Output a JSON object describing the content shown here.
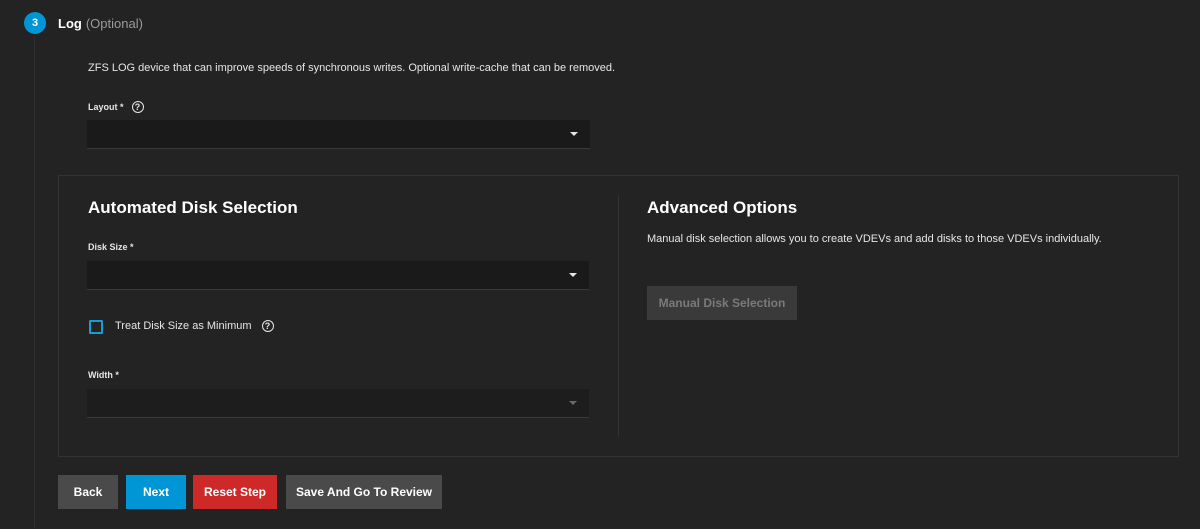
{
  "step": {
    "number": "3",
    "title": "Log",
    "optional": "(Optional)",
    "description": "ZFS LOG device that can improve speeds of synchronous writes. Optional write-cache that can be removed."
  },
  "layout_field": {
    "label": "Layout *",
    "value": ""
  },
  "automated": {
    "title": "Automated Disk Selection",
    "disk_size_label": "Disk Size *",
    "disk_size_value": "",
    "treat_min_label": "Treat Disk Size as Minimum",
    "treat_min_checked": false,
    "width_label": "Width *",
    "width_value": ""
  },
  "advanced": {
    "title": "Advanced Options",
    "description": "Manual disk selection allows you to create VDEVs and add disks to those VDEVs individually.",
    "manual_button": "Manual Disk Selection"
  },
  "actions": {
    "back": "Back",
    "next": "Next",
    "reset": "Reset Step",
    "review": "Save And Go To Review"
  },
  "colors": {
    "accent": "#0095d5",
    "danger": "#ce2929",
    "background": "#232323"
  }
}
